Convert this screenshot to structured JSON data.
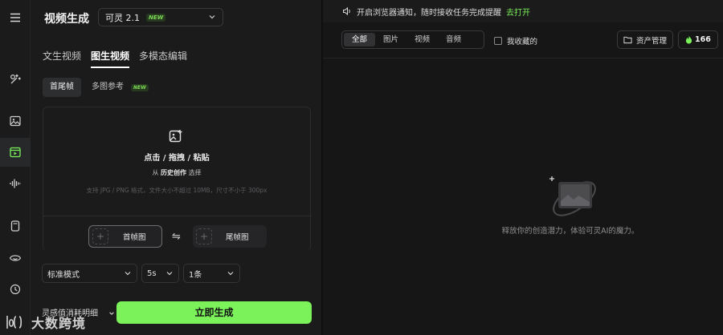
{
  "app": {
    "title": "视频生成",
    "model": {
      "name": "可灵 2.1",
      "badge": "NEW"
    }
  },
  "tabs": [
    {
      "label": "文生视频",
      "active": false
    },
    {
      "label": "图生视频",
      "active": true
    },
    {
      "label": "多模态编辑",
      "active": false
    }
  ],
  "subtabs": [
    {
      "label": "首尾帧",
      "active": true
    },
    {
      "label": "多图参考",
      "badge": "NEW"
    }
  ],
  "upload": {
    "main": "点击 / 拖拽 / 粘贴",
    "from": "从",
    "history": "历史创作",
    "select": "选择",
    "hint": "支持 JPG / PNG 格式，文件大小不超过 10MB，尺寸不小于 300px"
  },
  "frames": {
    "first": "首帧图",
    "last": "尾帧图"
  },
  "settings": {
    "mode": "标准模式",
    "duration": "5s",
    "count": "1条"
  },
  "footer": {
    "credits_label": "灵感值消耗明细",
    "generate": "立即生成"
  },
  "watermark": "大数跨境",
  "notice": {
    "text": "开启浏览器通知，随时接收任务完成提醒",
    "link": "去打开"
  },
  "filters": [
    "全部",
    "图片",
    "视频",
    "音频"
  ],
  "favorites_label": "我收藏的",
  "asset_button": "资产管理",
  "credit_balance": "166",
  "empty_text": "释放你的创造潜力，体验可灵AI的魔力。",
  "colors": {
    "accent": "#7bf25a",
    "background": "#141414",
    "panel": "#1b1b1c"
  }
}
